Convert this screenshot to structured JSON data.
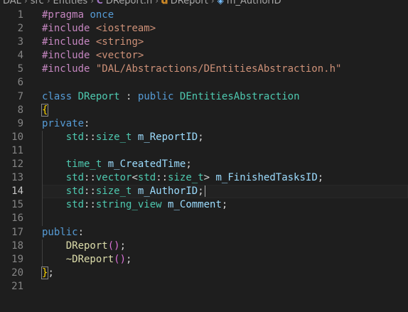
{
  "breadcrumb": {
    "items": [
      "DAL",
      "src",
      "Entities",
      "DReport.h",
      "DReport",
      "m_AuthorID"
    ],
    "file_icon": "C",
    "class_icon": "class-icon",
    "field_icon": "field-icon"
  },
  "editor": {
    "active_line": 14,
    "lines": [
      {
        "n": "1",
        "tokens": [
          [
            "t-pp",
            "#pragma"
          ],
          [
            "t-plain",
            " "
          ],
          [
            "t-kw",
            "once"
          ]
        ]
      },
      {
        "n": "2",
        "tokens": [
          [
            "t-pp",
            "#include"
          ],
          [
            "t-plain",
            " "
          ],
          [
            "t-str",
            "<iostream>"
          ]
        ]
      },
      {
        "n": "3",
        "tokens": [
          [
            "t-pp",
            "#include"
          ],
          [
            "t-plain",
            " "
          ],
          [
            "t-str",
            "<string>"
          ]
        ]
      },
      {
        "n": "4",
        "tokens": [
          [
            "t-pp",
            "#include"
          ],
          [
            "t-plain",
            " "
          ],
          [
            "t-str",
            "<vector>"
          ]
        ]
      },
      {
        "n": "5",
        "tokens": [
          [
            "t-pp",
            "#include"
          ],
          [
            "t-plain",
            " "
          ],
          [
            "t-str",
            "\"DAL/Abstractions/DEntitiesAbstraction.h\""
          ]
        ]
      },
      {
        "n": "6",
        "tokens": []
      },
      {
        "n": "7",
        "tokens": [
          [
            "t-kw",
            "class"
          ],
          [
            "t-plain",
            " "
          ],
          [
            "t-type",
            "DReport"
          ],
          [
            "t-plain",
            " : "
          ],
          [
            "t-kw",
            "public"
          ],
          [
            "t-plain",
            " "
          ],
          [
            "t-type",
            "DEntitiesAbstraction"
          ]
        ]
      },
      {
        "n": "8",
        "tokens": [
          [
            "t-br1 bracket-match",
            "{"
          ]
        ]
      },
      {
        "n": "9",
        "tokens": [
          [
            "t-kw",
            "private"
          ],
          [
            "t-plain",
            ":"
          ]
        ]
      },
      {
        "n": "10",
        "tokens": [
          [
            "t-plain",
            "    "
          ],
          [
            "t-ns",
            "std"
          ],
          [
            "t-plain",
            "::"
          ],
          [
            "t-type",
            "size_t"
          ],
          [
            "t-plain",
            " "
          ],
          [
            "t-var",
            "m_ReportID"
          ],
          [
            "t-plain",
            ";"
          ]
        ]
      },
      {
        "n": "11",
        "tokens": []
      },
      {
        "n": "12",
        "tokens": [
          [
            "t-plain",
            "    "
          ],
          [
            "t-type",
            "time_t"
          ],
          [
            "t-plain",
            " "
          ],
          [
            "t-var",
            "m_CreatedTime"
          ],
          [
            "t-plain",
            ";"
          ]
        ]
      },
      {
        "n": "13",
        "tokens": [
          [
            "t-plain",
            "    "
          ],
          [
            "t-ns",
            "std"
          ],
          [
            "t-plain",
            "::"
          ],
          [
            "t-type",
            "vector"
          ],
          [
            "t-plain",
            "<"
          ],
          [
            "t-ns",
            "std"
          ],
          [
            "t-plain",
            "::"
          ],
          [
            "t-type",
            "size_t"
          ],
          [
            "t-plain",
            "> "
          ],
          [
            "t-var",
            "m_FinishedTasksID"
          ],
          [
            "t-plain",
            ";"
          ]
        ]
      },
      {
        "n": "14",
        "tokens": [
          [
            "t-plain",
            "    "
          ],
          [
            "t-ns",
            "std"
          ],
          [
            "t-plain",
            "::"
          ],
          [
            "t-type",
            "size_t"
          ],
          [
            "t-plain",
            " "
          ],
          [
            "t-var",
            "m_AuthorID"
          ],
          [
            "t-plain",
            ";"
          ]
        ]
      },
      {
        "n": "15",
        "tokens": [
          [
            "t-plain",
            "    "
          ],
          [
            "t-ns",
            "std"
          ],
          [
            "t-plain",
            "::"
          ],
          [
            "t-type",
            "string_view"
          ],
          [
            "t-plain",
            " "
          ],
          [
            "t-var",
            "m_Comment"
          ],
          [
            "t-plain",
            ";"
          ]
        ]
      },
      {
        "n": "16",
        "tokens": []
      },
      {
        "n": "17",
        "tokens": [
          [
            "t-kw",
            "public"
          ],
          [
            "t-plain",
            ":"
          ]
        ]
      },
      {
        "n": "18",
        "tokens": [
          [
            "t-plain",
            "    "
          ],
          [
            "t-fn",
            "DReport"
          ],
          [
            "t-br2",
            "()"
          ],
          [
            "t-plain",
            ";"
          ]
        ]
      },
      {
        "n": "19",
        "tokens": [
          [
            "t-plain",
            "    "
          ],
          [
            "t-fn",
            "~DReport"
          ],
          [
            "t-br2",
            "()"
          ],
          [
            "t-plain",
            ";"
          ]
        ]
      },
      {
        "n": "20",
        "tokens": [
          [
            "t-br1 bracket-match",
            "}"
          ],
          [
            "t-plain",
            ";"
          ]
        ]
      },
      {
        "n": "21",
        "tokens": []
      }
    ]
  }
}
